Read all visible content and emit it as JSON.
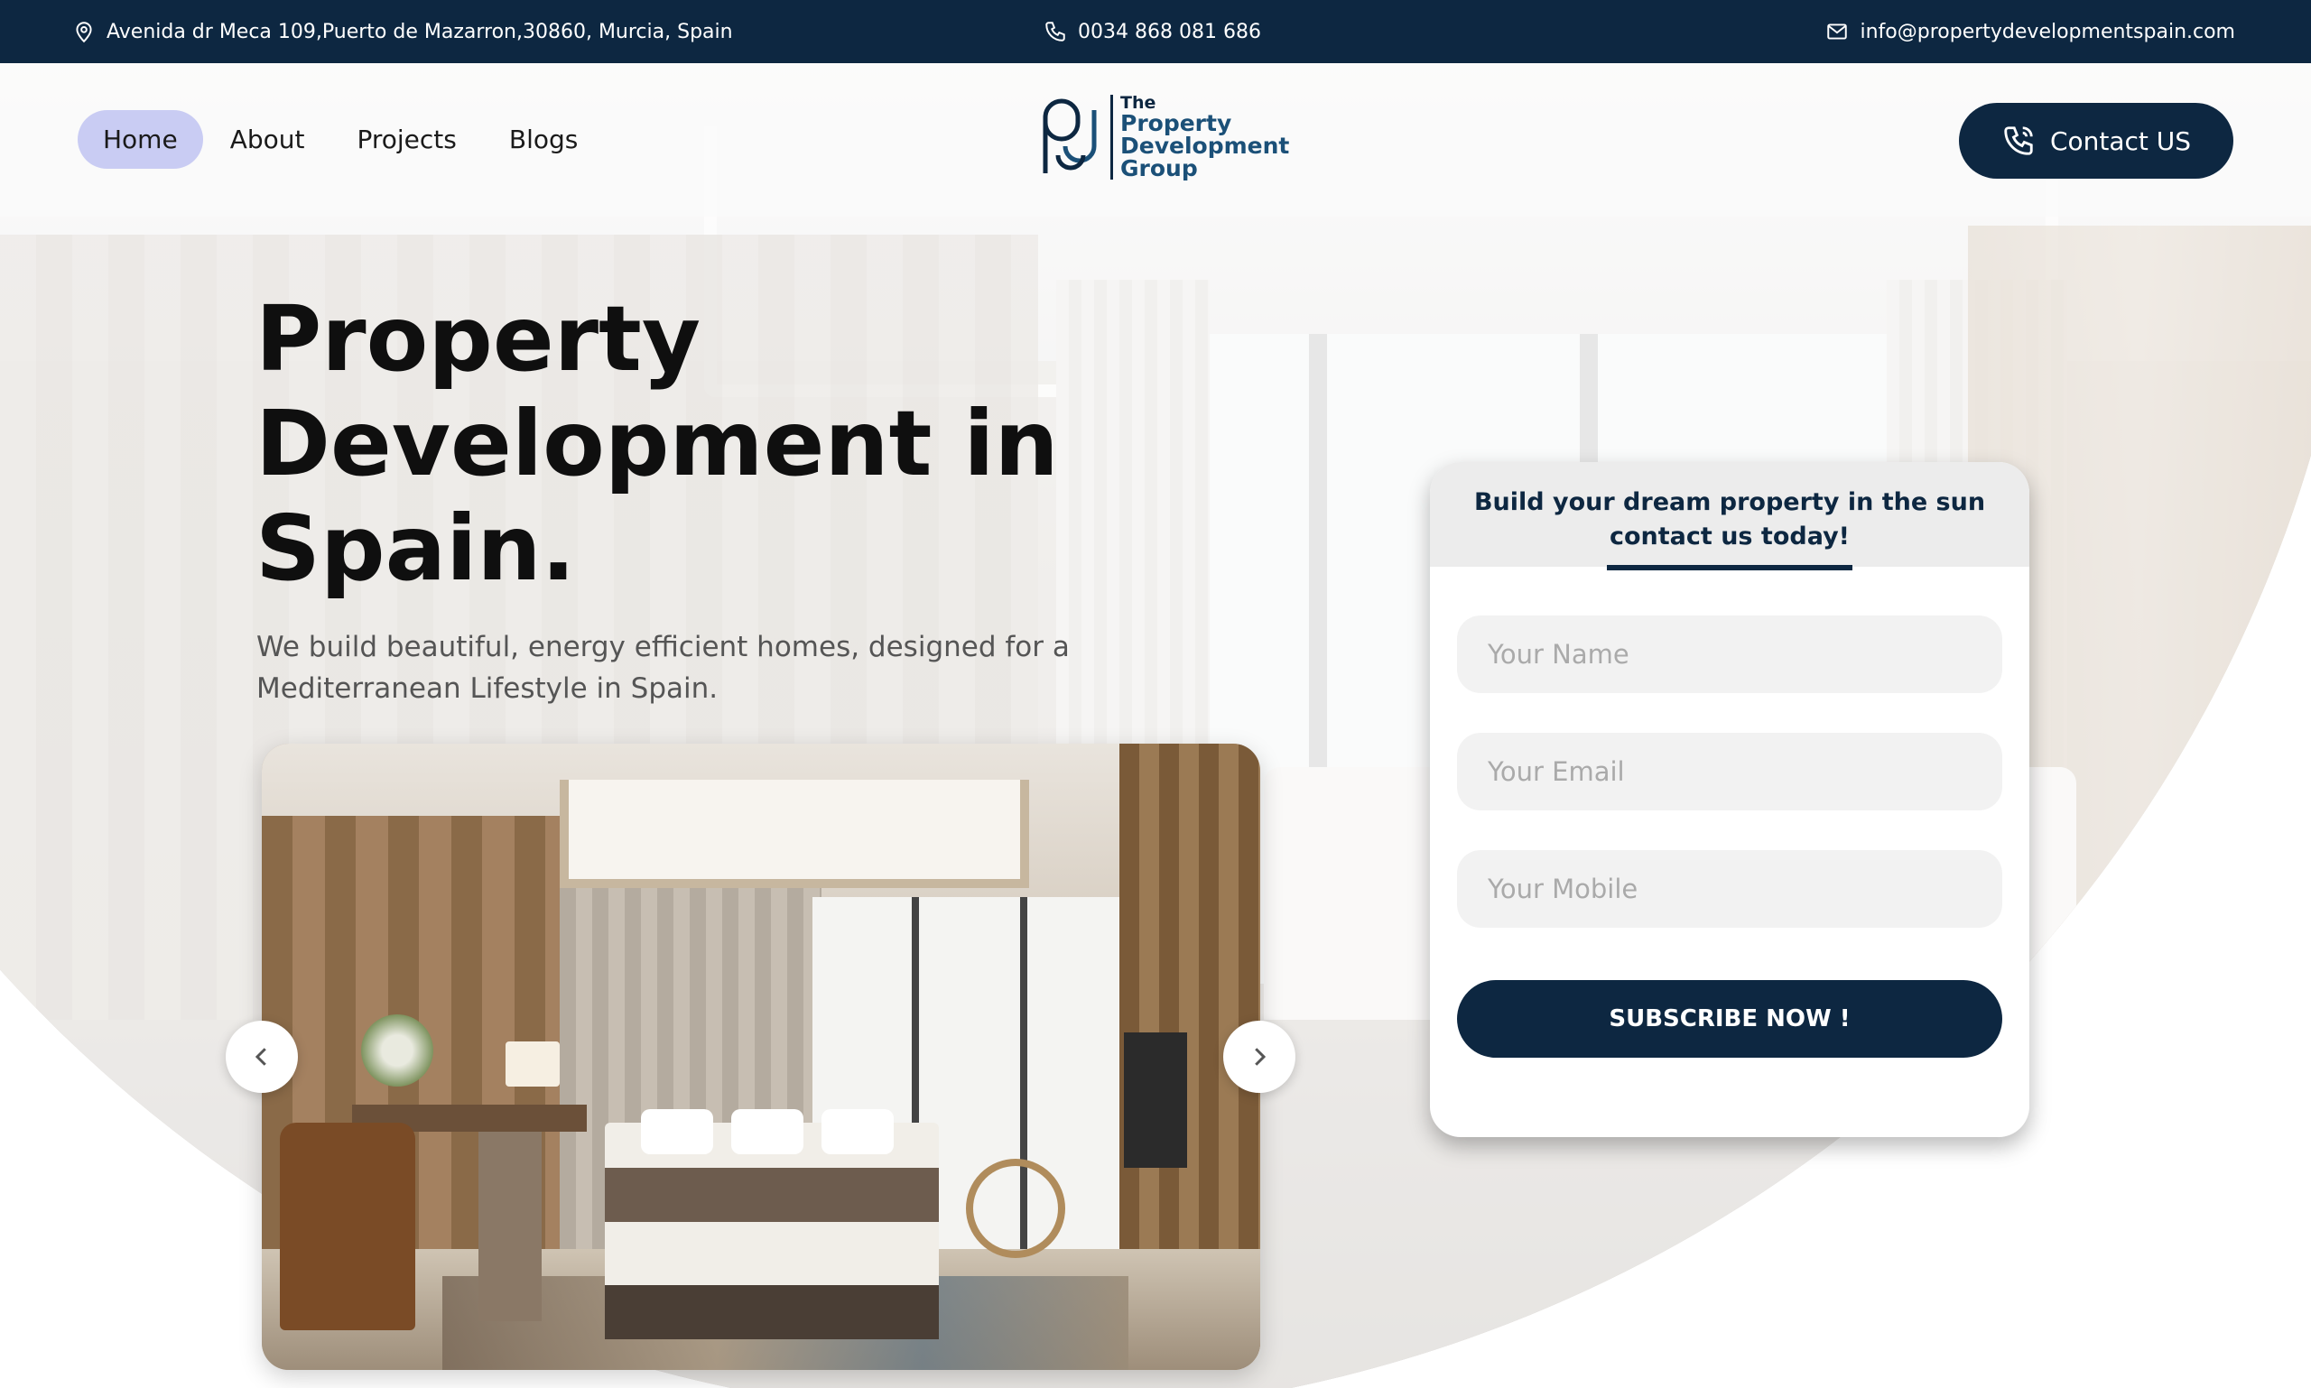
{
  "topbar": {
    "address": "Avenida dr Meca 109,Puerto de Mazarron,30860, Murcia, Spain",
    "phone": "0034 868 081 686",
    "email": "info@propertydevelopmentspain.com"
  },
  "nav": {
    "items": [
      {
        "label": "Home",
        "active": true
      },
      {
        "label": "About",
        "active": false
      },
      {
        "label": "Projects",
        "active": false
      },
      {
        "label": "Blogs",
        "active": false
      }
    ],
    "logo": {
      "line1": "The",
      "line2": "Property",
      "line3": "Development",
      "line4": "Group"
    },
    "contact_button": "Contact US"
  },
  "hero": {
    "title_line1": "Property",
    "title_line2": "Development in",
    "title_line3": "Spain.",
    "subtitle_line1": "We build beautiful, energy efficient homes, designed for a",
    "subtitle_line2": "Mediterranean Lifestyle in Spain."
  },
  "form": {
    "heading_line1": "Build your dream property in the sun",
    "heading_line2": "contact us today!",
    "name_placeholder": "Your Name",
    "email_placeholder": "Your Email",
    "mobile_placeholder": "Your Mobile",
    "submit_label": "SUBSCRIBE NOW !"
  },
  "icons": {
    "address": "map-pin-icon",
    "phone": "phone-icon",
    "email": "envelope-icon",
    "contact": "phone-call-icon",
    "prev": "chevron-left-icon",
    "next": "chevron-right-icon"
  },
  "colors": {
    "brand_navy": "#0d2741",
    "nav_active": "#c9ccf3",
    "field_bg": "#f2f2f2"
  }
}
